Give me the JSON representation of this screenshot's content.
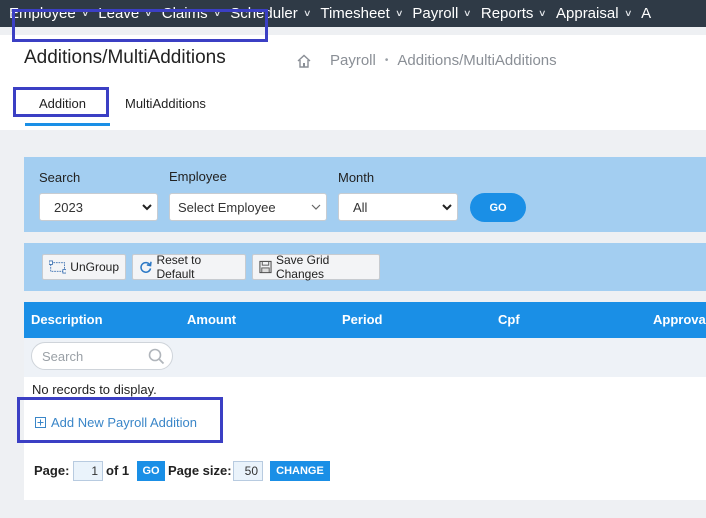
{
  "nav": {
    "items": [
      {
        "label": "Employee"
      },
      {
        "label": "Leave"
      },
      {
        "label": "Claims"
      },
      {
        "label": "Scheduler"
      },
      {
        "label": "Timesheet"
      },
      {
        "label": "Payroll"
      },
      {
        "label": "Reports"
      },
      {
        "label": "Appraisal"
      },
      {
        "label": "A"
      }
    ]
  },
  "header": {
    "title": "Additions/MultiAdditions",
    "breadcrumb": {
      "home_icon": "home-icon",
      "items": [
        "Payroll",
        "Additions/MultiAdditions"
      ],
      "separator": "•"
    }
  },
  "tabs": [
    {
      "label": "Addition",
      "active": true
    },
    {
      "label": "MultiAdditions",
      "active": false
    }
  ],
  "filters": {
    "search_label": "Search",
    "search_value": "2023",
    "employee_label": "Employee",
    "employee_value": "Select Employee",
    "month_label": "Month",
    "month_value": "All",
    "go_label": "GO"
  },
  "toolbar": {
    "ungroup_label": "UnGroup",
    "reset_label": "Reset to Default",
    "save_label": "Save Grid Changes"
  },
  "grid": {
    "columns": [
      "Description",
      "Amount",
      "Period",
      "Cpf",
      "Approva"
    ],
    "search_placeholder": "Search",
    "empty_text": "No records to display.",
    "add_label": "Add New Payroll Addition"
  },
  "pager": {
    "page_label": "Page:",
    "page_value": "1",
    "of_label": "of 1",
    "go_label": "GO",
    "size_label": "Page size:",
    "size_value": "50",
    "change_label": "CHANGE"
  },
  "colors": {
    "nav_bg": "#2f3a46",
    "panel_bg": "#a3cef1",
    "accent": "#1a8fe6",
    "highlight_box": "#3b3fc4",
    "link": "#3a86c8"
  }
}
